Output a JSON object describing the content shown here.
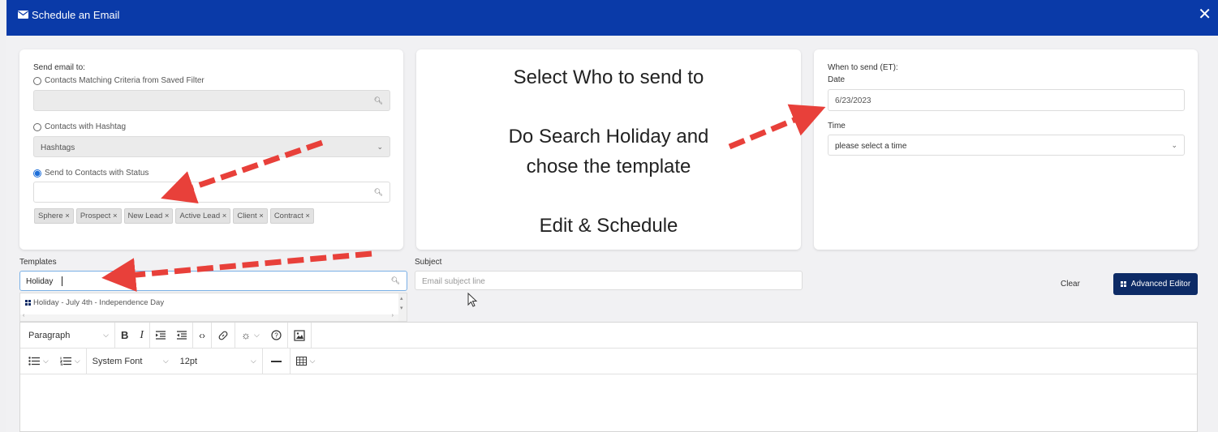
{
  "window": {
    "title": "Schedule an Email",
    "close_glyph": "✕"
  },
  "recipients": {
    "heading": "Send email to:",
    "option_saved_filter": "Contacts Matching Criteria from Saved Filter",
    "option_hashtag": "Contacts with Hashtag",
    "hashtag_select_value": "Hashtags",
    "option_status": "Send to Contacts with Status",
    "selected_option": "status",
    "status_chips": [
      "Sphere",
      "Prospect",
      "New Lead",
      "Active Lead",
      "Client",
      "Contract"
    ]
  },
  "instructions": {
    "line1": "Select Who to send to",
    "line2a": "Do Search Holiday and",
    "line2b": "chose the template",
    "line3": "Edit & Schedule"
  },
  "schedule": {
    "heading": "When to send (ET):",
    "date_label": "Date",
    "date_value": "6/23/2023",
    "time_label": "Time",
    "time_value": "please select a time"
  },
  "templates": {
    "label": "Templates",
    "search_value": "Holiday",
    "result_item": "Holiday - July 4th - Independence Day"
  },
  "subject": {
    "label": "Subject",
    "placeholder": "Email subject line"
  },
  "actions": {
    "clear_label": "Clear",
    "advanced_editor_label": "Advanced Editor"
  },
  "editor_toolbar": {
    "block_format": "Paragraph",
    "font_family": "System Font",
    "font_size": "12pt",
    "bold": "B",
    "italic": "I"
  },
  "colors": {
    "titlebar": "#0a3aa8",
    "advanced_button": "#0d2b66",
    "arrow": "#e8403a"
  }
}
